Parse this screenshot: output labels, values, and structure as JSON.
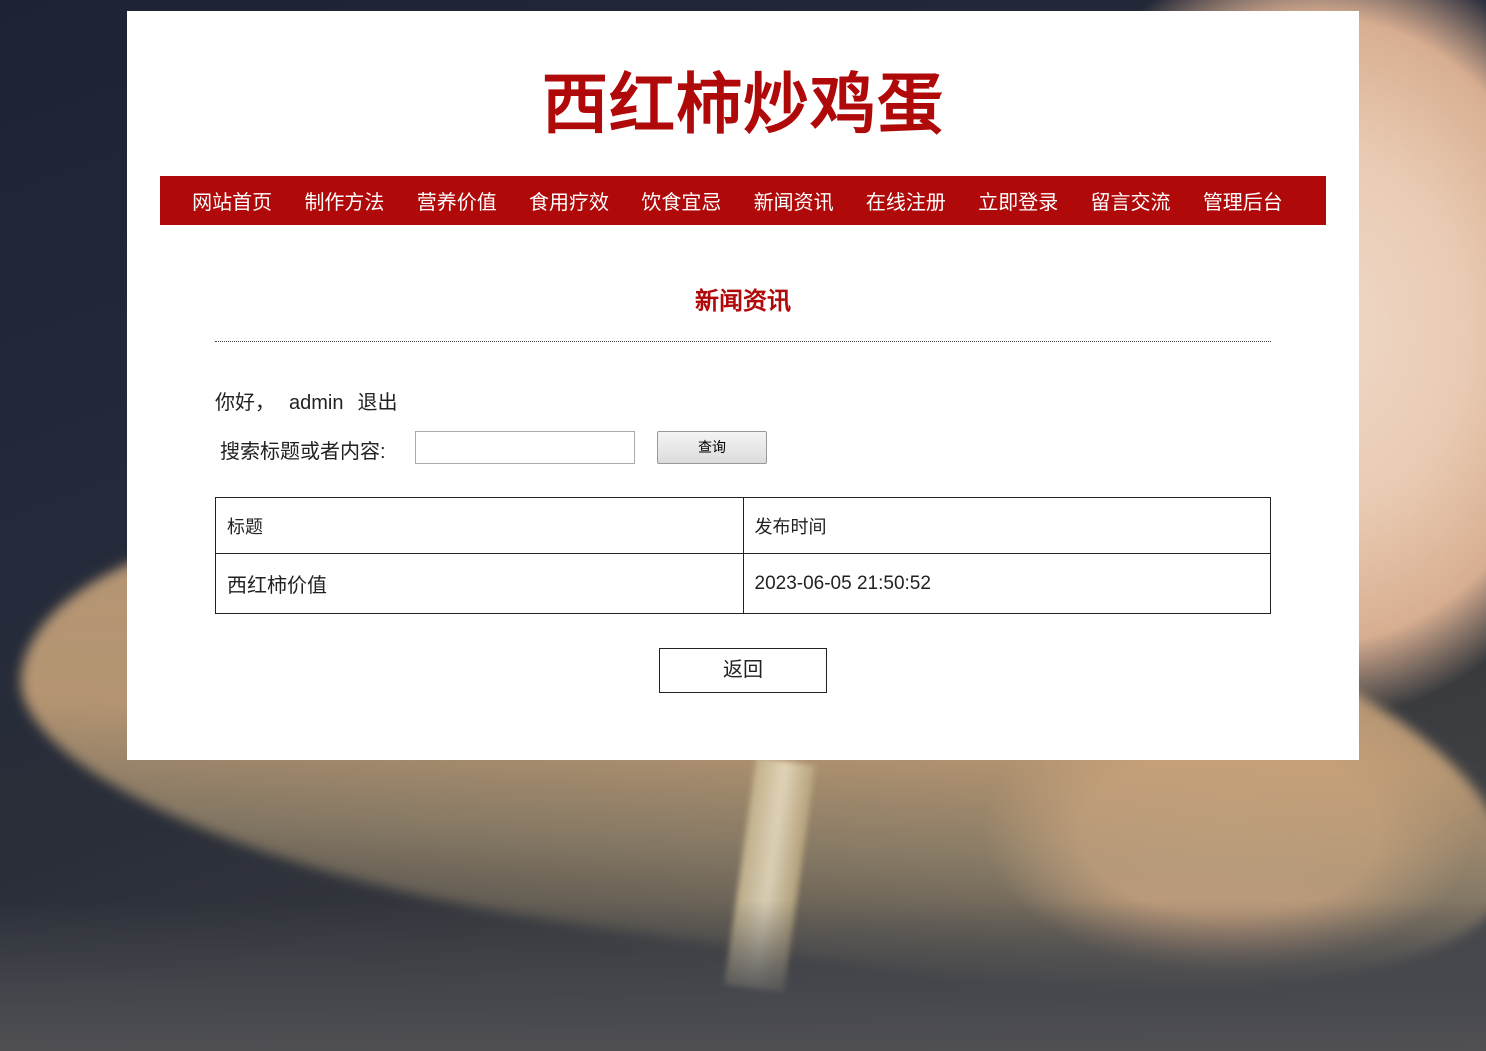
{
  "site": {
    "title": "西红柿炒鸡蛋"
  },
  "nav": {
    "items": [
      "网站首页",
      "制作方法",
      "营养价值",
      "食用疗效",
      "饮食宜忌",
      "新闻资讯",
      "在线注册",
      "立即登录",
      "留言交流",
      "管理后台"
    ]
  },
  "section": {
    "title": "新闻资讯"
  },
  "user": {
    "greeting": "你好，",
    "name": "admin",
    "logout": "退出"
  },
  "search": {
    "label": "搜索标题或者内容:",
    "value": "",
    "button": "查询"
  },
  "table": {
    "headers": [
      "标题",
      "发布时间"
    ],
    "rows": [
      [
        "西红柿价值",
        "2023-06-05 21:50:52"
      ]
    ]
  },
  "back_button": "返回",
  "colors": {
    "brand": "#b0090a"
  }
}
